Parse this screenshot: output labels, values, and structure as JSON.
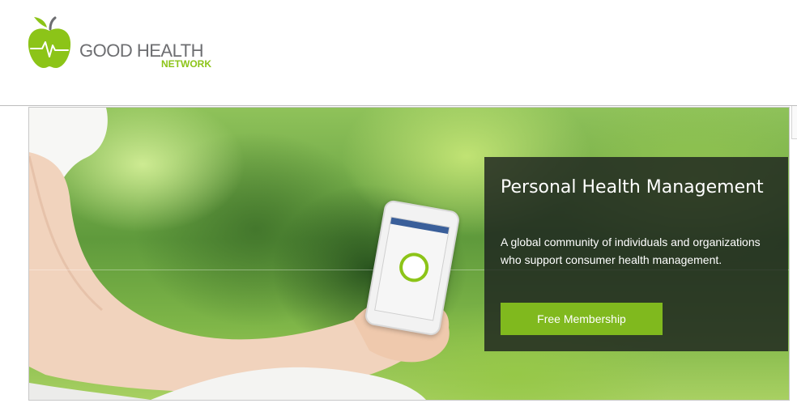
{
  "brand": {
    "name_main": "GOOD HEALTH",
    "name_sub": "NETWORK",
    "icon": "apple-heartbeat-logo",
    "colors": {
      "green": "#8cc418",
      "gray": "#6d6e71"
    }
  },
  "hero": {
    "title": "Personal Health Management",
    "description": "A global community of individuals and organizations who support consumer health management.",
    "cta_label": "Free Membership",
    "colors": {
      "panel": "#1c221e",
      "cta": "#80b91e"
    }
  }
}
